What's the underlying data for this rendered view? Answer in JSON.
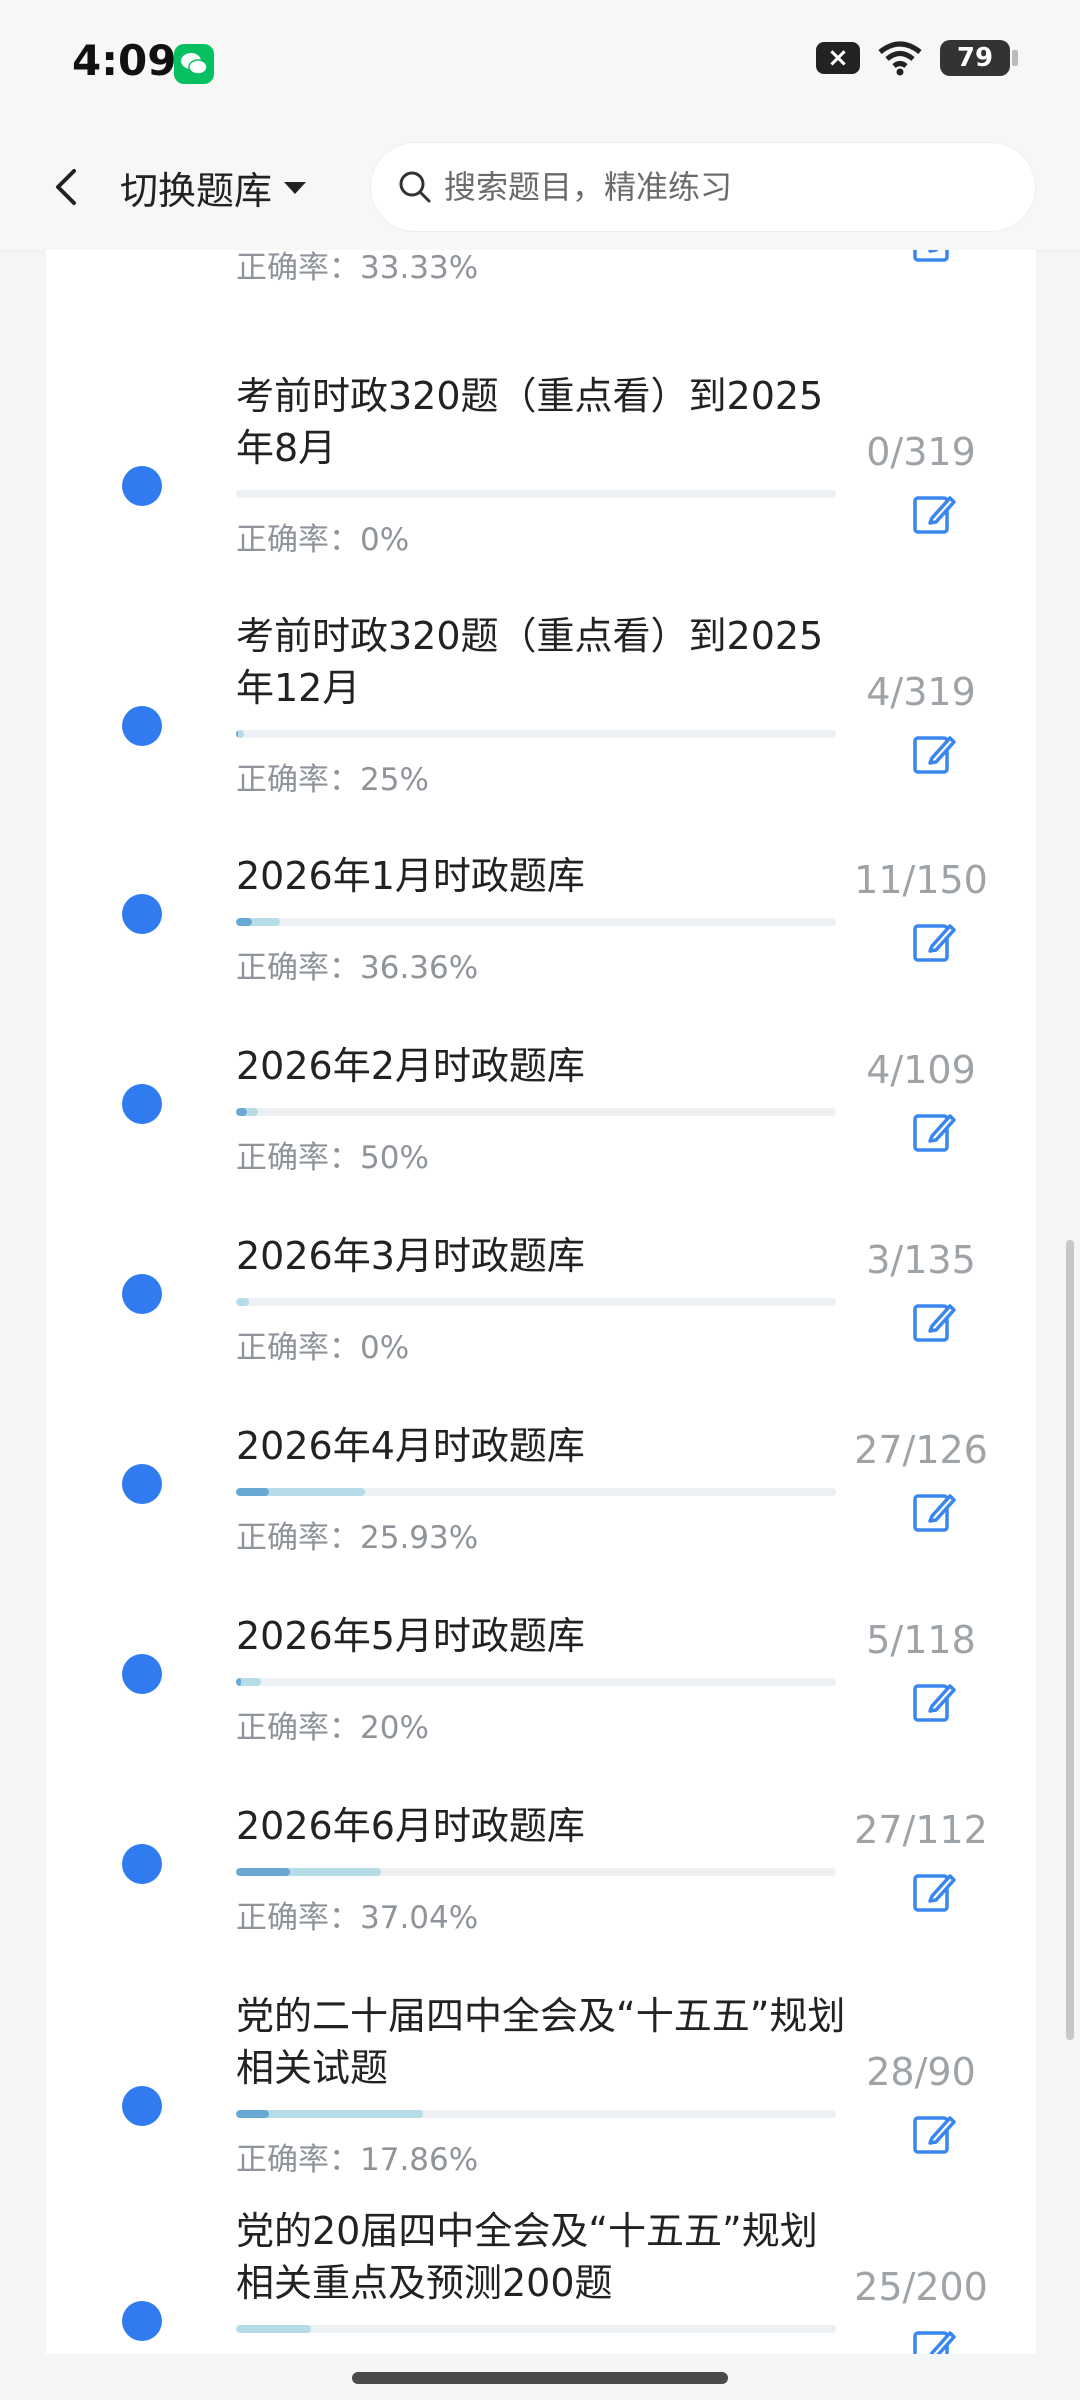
{
  "status_bar": {
    "time": "4:09",
    "battery": "79"
  },
  "header": {
    "switch_label": "切换题库",
    "search_placeholder": "搜索题目，精准练习"
  },
  "list": [
    {
      "title": "",
      "count": "",
      "accuracy": "正确率：33.33%",
      "progress": 0.0,
      "accuracy_value": 0.0
    },
    {
      "title": "考前时政320题（重点看）到2025年8月",
      "count": "0/319",
      "accuracy": "正确率：0%",
      "progress": 0.0,
      "accuracy_value": 0.0
    },
    {
      "title": "考前时政320题（重点看）到2025年12月",
      "count": "4/319",
      "accuracy": "正确率：25%",
      "progress": 0.0125,
      "accuracy_value": 0.25
    },
    {
      "title": "2026年1月时政题库",
      "count": "11/150",
      "accuracy": "正确率：36.36%",
      "progress": 0.0733,
      "accuracy_value": 0.3636
    },
    {
      "title": "2026年2月时政题库",
      "count": "4/109",
      "accuracy": "正确率：50%",
      "progress": 0.0367,
      "accuracy_value": 0.5
    },
    {
      "title": "2026年3月时政题库",
      "count": "3/135",
      "accuracy": "正确率：0%",
      "progress": 0.0222,
      "accuracy_value": 0.0
    },
    {
      "title": "2026年4月时政题库",
      "count": "27/126",
      "accuracy": "正确率：25.93%",
      "progress": 0.2143,
      "accuracy_value": 0.2593
    },
    {
      "title": "2026年5月时政题库",
      "count": "5/118",
      "accuracy": "正确率：20%",
      "progress": 0.0424,
      "accuracy_value": 0.2
    },
    {
      "title": "2026年6月时政题库",
      "count": "27/112",
      "accuracy": "正确率：37.04%",
      "progress": 0.2411,
      "accuracy_value": 0.3704
    },
    {
      "title": "党的二十届四中全会及“十五五”规划相关试题",
      "count": "28/90",
      "accuracy": "正确率：17.86%",
      "progress": 0.3111,
      "accuracy_value": 0.1786
    },
    {
      "title": "党的20届四中全会及“十五五”规划相关重点及预测200题",
      "count": "25/200",
      "accuracy": "",
      "progress": 0.125,
      "accuracy_value": 0.0
    }
  ]
}
